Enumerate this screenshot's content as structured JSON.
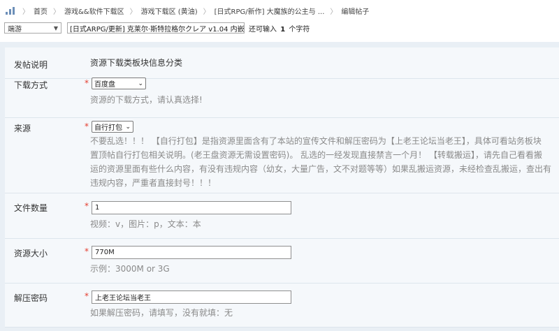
{
  "breadcrumb": {
    "items": [
      "首页",
      "游戏&&软件下载区",
      "游戏下载区 (黄油)",
      "[日式RPG/新作] 大魔族的公主与 ...",
      "编辑帖子"
    ]
  },
  "header": {
    "type_select": "端游",
    "title_value": "[日式ARPG/更新] 克莱尔·斯特拉格尔クレア v1.04 内嵌AI",
    "remaining_prefix": "还可输入",
    "remaining_count": "1",
    "remaining_suffix": "个字符"
  },
  "form": {
    "post_desc": {
      "label": "发帖说明",
      "value": "资源下载类板块信息分类"
    },
    "download_method": {
      "label": "下载方式",
      "selected": "百度盘",
      "hint": "资源的下载方式，请认真选择!"
    },
    "source": {
      "label": "来源",
      "selected": "自行打包",
      "hint_lines": [
        "不要乱选！！！ 【自行打包】是指资源里面含有了本站的宣传文件和解压密码为【上老王论坛当老王】，具体可看站务板块",
        "置顶帖自行打包相关说明。(老王盘资源无需设置密码)。 乱选的一经发现直接禁言一个月！ 【转载搬运】，请先自己看看搬",
        "运的资源里面有些什么内容，有没有违规内容（幼女，大量广告，文不对题等等）如果乱搬运资源，未经检查乱搬运，查出有",
        "违规内容，严重者直接封号！！！"
      ]
    },
    "file_count": {
      "label": "文件数量",
      "value": "1",
      "hint": "视频：v，图片：p，文本：本"
    },
    "size": {
      "label": "资源大小",
      "value": "770M",
      "hint": "示例：3000M or 3G"
    },
    "password": {
      "label": "解压密码",
      "value": "上老王论坛当老王",
      "hint": "如果解压密码，请填写，没有就填：无"
    }
  },
  "icons": {
    "home": "stats-bars-icon",
    "caret": "chevron-down-icon"
  },
  "colors": {
    "required_star": "#e43d2f",
    "form_bg": "#e9eff5",
    "row_bg": "#f5f8fb",
    "hint_text": "#8a8a8a"
  }
}
